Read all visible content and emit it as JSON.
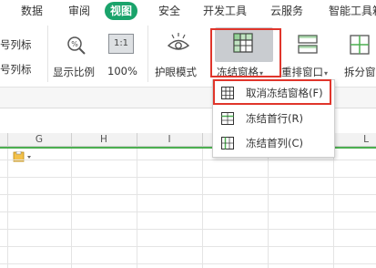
{
  "tabs": [
    {
      "label": "数据",
      "active": false
    },
    {
      "label": "审阅",
      "active": false
    },
    {
      "label": "视图",
      "active": true
    },
    {
      "label": "安全",
      "active": false
    },
    {
      "label": "开发工具",
      "active": false
    },
    {
      "label": "云服务",
      "active": false
    },
    {
      "label": "智能工具箱",
      "active": false
    }
  ],
  "ribbon": {
    "left_items": [
      "号列标",
      "号列标"
    ],
    "zoom_display_label": "显示比例",
    "zoom_100_icon_text": "1:1",
    "zoom_100_label": "100%",
    "eye_mode_label": "护眼模式",
    "freeze_panes_label": "冻结窗格",
    "rearrange_label": "重排窗口",
    "split_label": "拆分窗"
  },
  "columns": [
    "G",
    "H",
    "I",
    "K",
    "L"
  ],
  "freeze_menu": {
    "items": [
      {
        "label": "取消冻结窗格(F)",
        "highlighted": true
      },
      {
        "label": "冻结首行(R)",
        "highlighted": false
      },
      {
        "label": "冻结首列(C)",
        "highlighted": false
      }
    ]
  },
  "colors": {
    "active_tab": "#1aa36b",
    "highlight_box": "#e0352b",
    "freeze_line": "#4caf50"
  }
}
